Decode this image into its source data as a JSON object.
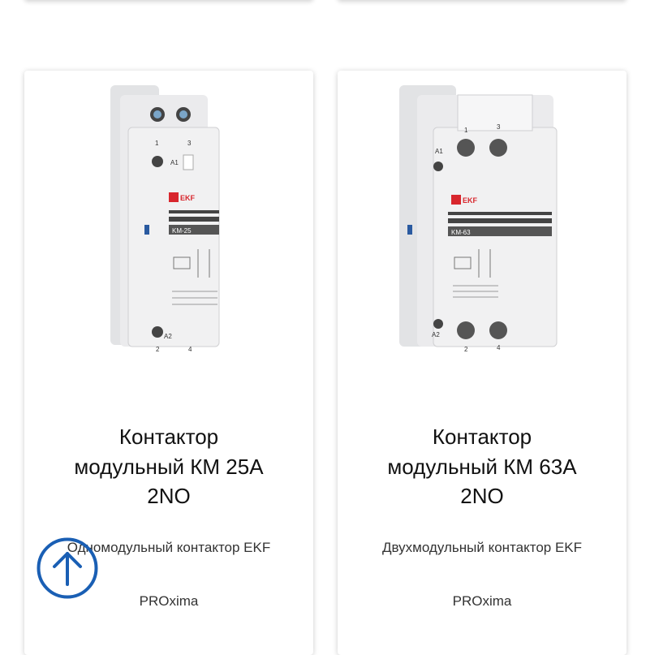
{
  "products": [
    {
      "title_lines": [
        "Контактор",
        "модульный КМ 25А",
        "2NO"
      ],
      "description": "Одномодульный контактор EKF",
      "brand": "PROxima",
      "device": {
        "brand_logo": "EKF",
        "model": "KM-25",
        "terminals_top": [
          "1",
          "3"
        ],
        "terminals_bottom": [
          "2",
          "4"
        ],
        "a1": "A1",
        "a2": "A2"
      }
    },
    {
      "title_lines": [
        "Контактор",
        "модульный КМ 63А",
        "2NO"
      ],
      "description": "Двухмодульный контактор EKF",
      "brand": "PROxima",
      "device": {
        "brand_logo": "EKF",
        "model": "KM-63",
        "terminals_top": [
          "1",
          "3"
        ],
        "terminals_bottom": [
          "2",
          "4"
        ],
        "a1": "A1",
        "a2": "A2"
      }
    }
  ],
  "scroll_top_icon": "arrow-up-circle-icon",
  "colors": {
    "accent": "#1a5fb4",
    "brand_red": "#d8262d"
  }
}
